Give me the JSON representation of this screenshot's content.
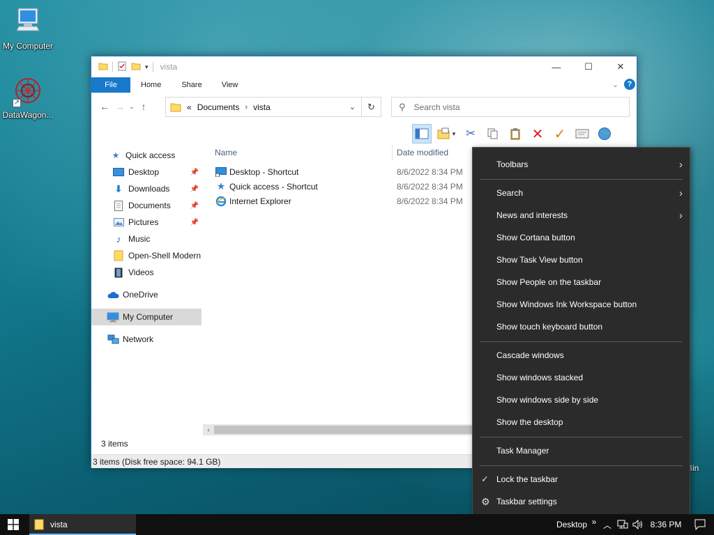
{
  "desktop": {
    "icons": [
      {
        "label": "My Computer"
      },
      {
        "label": "DataWagon..."
      }
    ],
    "bin_label_partial": "Bin"
  },
  "explorer": {
    "title": "vista",
    "ribbon_tabs": [
      "File",
      "Home",
      "Share",
      "View"
    ],
    "address": {
      "overflow": "«",
      "crumbs": [
        "Documents",
        "vista"
      ]
    },
    "search_placeholder": "Search vista",
    "nav": {
      "quick_access": "Quick access",
      "items": [
        {
          "label": "Desktop",
          "pinned": true
        },
        {
          "label": "Downloads",
          "pinned": true
        },
        {
          "label": "Documents",
          "pinned": true
        },
        {
          "label": "Pictures",
          "pinned": true
        },
        {
          "label": "Music",
          "pinned": false
        },
        {
          "label": "Open-Shell Modern",
          "pinned": false
        },
        {
          "label": "Videos",
          "pinned": false
        }
      ],
      "onedrive": "OneDrive",
      "my_computer": "My Computer",
      "network": "Network"
    },
    "columns": {
      "name": "Name",
      "date": "Date modified"
    },
    "files": [
      {
        "name": "Desktop - Shortcut",
        "date": "8/6/2022 8:34 PM"
      },
      {
        "name": "Quick access - Shortcut",
        "date": "8/6/2022 8:34 PM"
      },
      {
        "name": "Internet Explorer",
        "date": "8/6/2022 8:34 PM"
      }
    ],
    "status_count": "3 items",
    "status_detail": "3 items (Disk free space: 94.1 GB)"
  },
  "context_menu": {
    "toolbars": "Toolbars",
    "search": "Search",
    "news": "News and interests",
    "cortana": "Show Cortana button",
    "taskview": "Show Task View button",
    "people": "Show People on the taskbar",
    "ink": "Show Windows Ink Workspace button",
    "touchkb": "Show touch keyboard button",
    "cascade": "Cascade windows",
    "stacked": "Show windows stacked",
    "sidebyside": "Show windows side by side",
    "showdesktop": "Show the desktop",
    "taskmgr": "Task Manager",
    "lock": "Lock the taskbar",
    "lock_checked": true,
    "settings": "Taskbar settings"
  },
  "taskbar": {
    "app_label": "vista",
    "desktop_toolbar": "Desktop",
    "chevron": "»",
    "clock": "8:36 PM"
  },
  "colors": {
    "accent": "#1979ca",
    "menu_bg": "#2b2b2b",
    "taskbar": "#101010"
  }
}
